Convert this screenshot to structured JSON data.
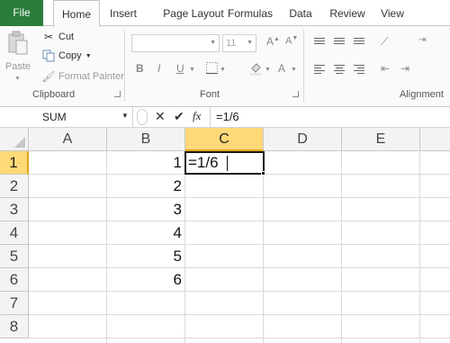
{
  "tabs": {
    "file": "File",
    "home": "Home",
    "insert": "Insert",
    "page_layout": "Page Layout",
    "formulas": "Formulas",
    "data": "Data",
    "review": "Review",
    "view": "View"
  },
  "ribbon": {
    "clipboard": {
      "paste": "Paste",
      "cut": "Cut",
      "copy": "Copy",
      "format_painter": "Format Painter",
      "label": "Clipboard"
    },
    "font": {
      "size": "11",
      "label": "Font"
    },
    "alignment": {
      "label": "Alignment"
    }
  },
  "formula_bar": {
    "name_box": "SUM",
    "content": "=1/6"
  },
  "sheet": {
    "columns": [
      "A",
      "B",
      "C",
      "D",
      "E"
    ],
    "rows": [
      "1",
      "2",
      "3",
      "4",
      "5",
      "6",
      "7",
      "8"
    ],
    "column_b_values": [
      "1",
      "2",
      "3",
      "4",
      "5",
      "6"
    ],
    "active_cell_text": "=1/6"
  },
  "colors": {
    "file_tab": "#2a7d3a",
    "selected_header": "#ffd978",
    "selected_header_border": "#e2a41c"
  }
}
